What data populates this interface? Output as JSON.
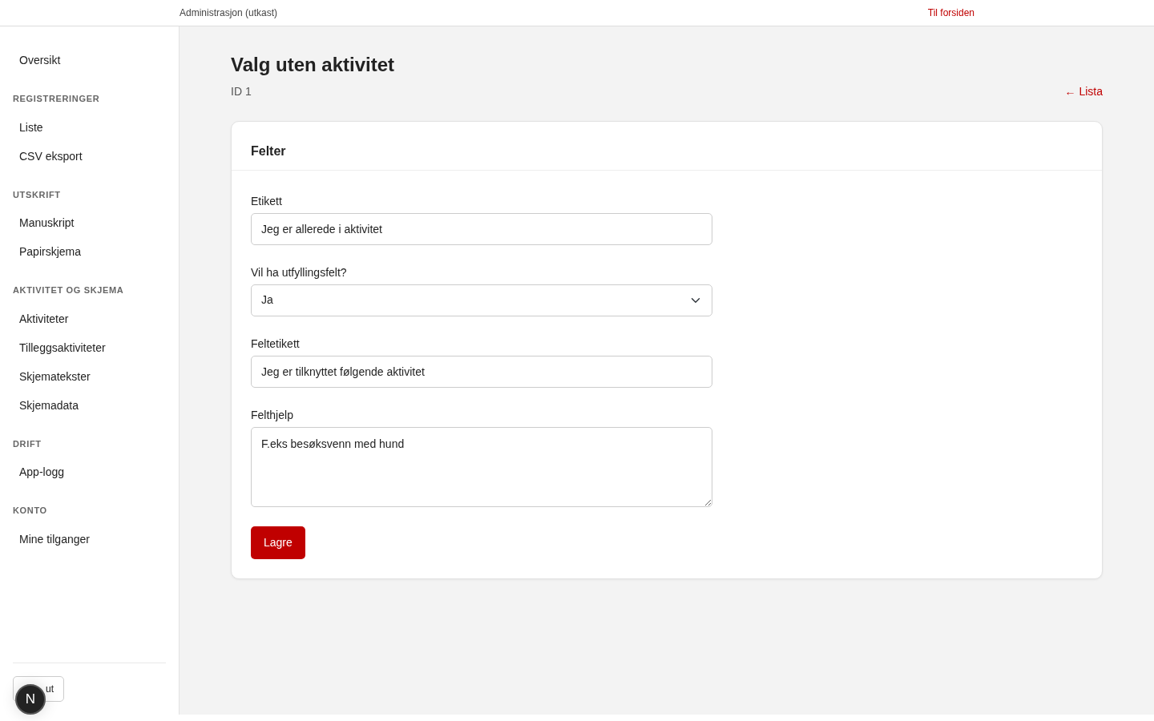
{
  "topbar": {
    "title": "Administrasjon (utkast)",
    "home_link": "Til forsiden"
  },
  "sidebar": {
    "sections": [
      {
        "items": [
          {
            "label": "Oversikt"
          }
        ]
      },
      {
        "heading": "REGISTRERINGER",
        "items": [
          {
            "label": "Liste"
          },
          {
            "label": "CSV eksport"
          }
        ]
      },
      {
        "heading": "UTSKRIFT",
        "items": [
          {
            "label": "Manuskript"
          },
          {
            "label": "Papirskjema"
          }
        ]
      },
      {
        "heading": "AKTIVITET OG SKJEMA",
        "items": [
          {
            "label": "Aktiviteter"
          },
          {
            "label": "Tilleggsaktiviteter"
          },
          {
            "label": "Skjematekster"
          },
          {
            "label": "Skjemadata"
          }
        ]
      },
      {
        "heading": "DRIFT",
        "items": [
          {
            "label": "App-logg"
          }
        ]
      },
      {
        "heading": "KONTO",
        "items": [
          {
            "label": "Mine tilganger"
          }
        ]
      }
    ],
    "logout_button": "ut",
    "dev_indicator": "N"
  },
  "page": {
    "title": "Valg uten aktivitet",
    "subtitle": "ID 1",
    "back_link": "← Lista"
  },
  "card": {
    "title": "Felter",
    "fields": [
      {
        "kind": "text",
        "label": "Etikett",
        "value": "Jeg er allerede i aktivitet"
      },
      {
        "kind": "select",
        "label": "Vil ha utfyllingsfelt?",
        "value": "Ja"
      },
      {
        "kind": "text",
        "label": "Feltetikett",
        "value": "Jeg er tilknyttet følgende aktivitet"
      },
      {
        "kind": "textarea",
        "label": "Felthjelp",
        "value": "F.eks besøksvenn med hund"
      }
    ],
    "save_button": "Lagre"
  }
}
